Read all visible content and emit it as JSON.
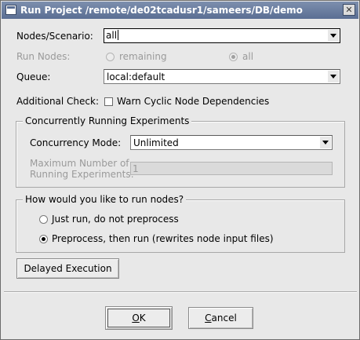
{
  "window": {
    "title": "Run Project /remote/de02tcadusr1/sameers/DB/demo",
    "close_glyph": "✕"
  },
  "form": {
    "nodes_scenario_label": "Nodes/Scenario:",
    "nodes_scenario_value": "all",
    "run_nodes_label": "Run Nodes:",
    "run_nodes_options": [
      "remaining",
      "all"
    ],
    "run_nodes_selected": "all",
    "queue_label": "Queue:",
    "queue_value": "local:default",
    "additional_check_label": "Additional Check:",
    "warn_cyclic_label": "Warn Cyclic Node Dependencies",
    "warn_cyclic_checked": false
  },
  "concurrency": {
    "group_title": "Concurrently Running Experiments",
    "mode_label": "Concurrency Mode:",
    "mode_value": "Unlimited",
    "max_label_line1": "Maximum Number of",
    "max_label_line2": "Running Experiments:",
    "max_value": "1"
  },
  "run_mode": {
    "group_title": "How would you like to run nodes?",
    "options": [
      "Just run, do not preprocess",
      "Preprocess, then run (rewrites node input files)"
    ],
    "selected": "Preprocess, then run (rewrites node input files)"
  },
  "actions": {
    "delayed_label": "Delayed Execution",
    "ok_mnemonic": "O",
    "ok_rest": "K",
    "cancel_mnemonic": "C",
    "cancel_rest": "ancel"
  }
}
